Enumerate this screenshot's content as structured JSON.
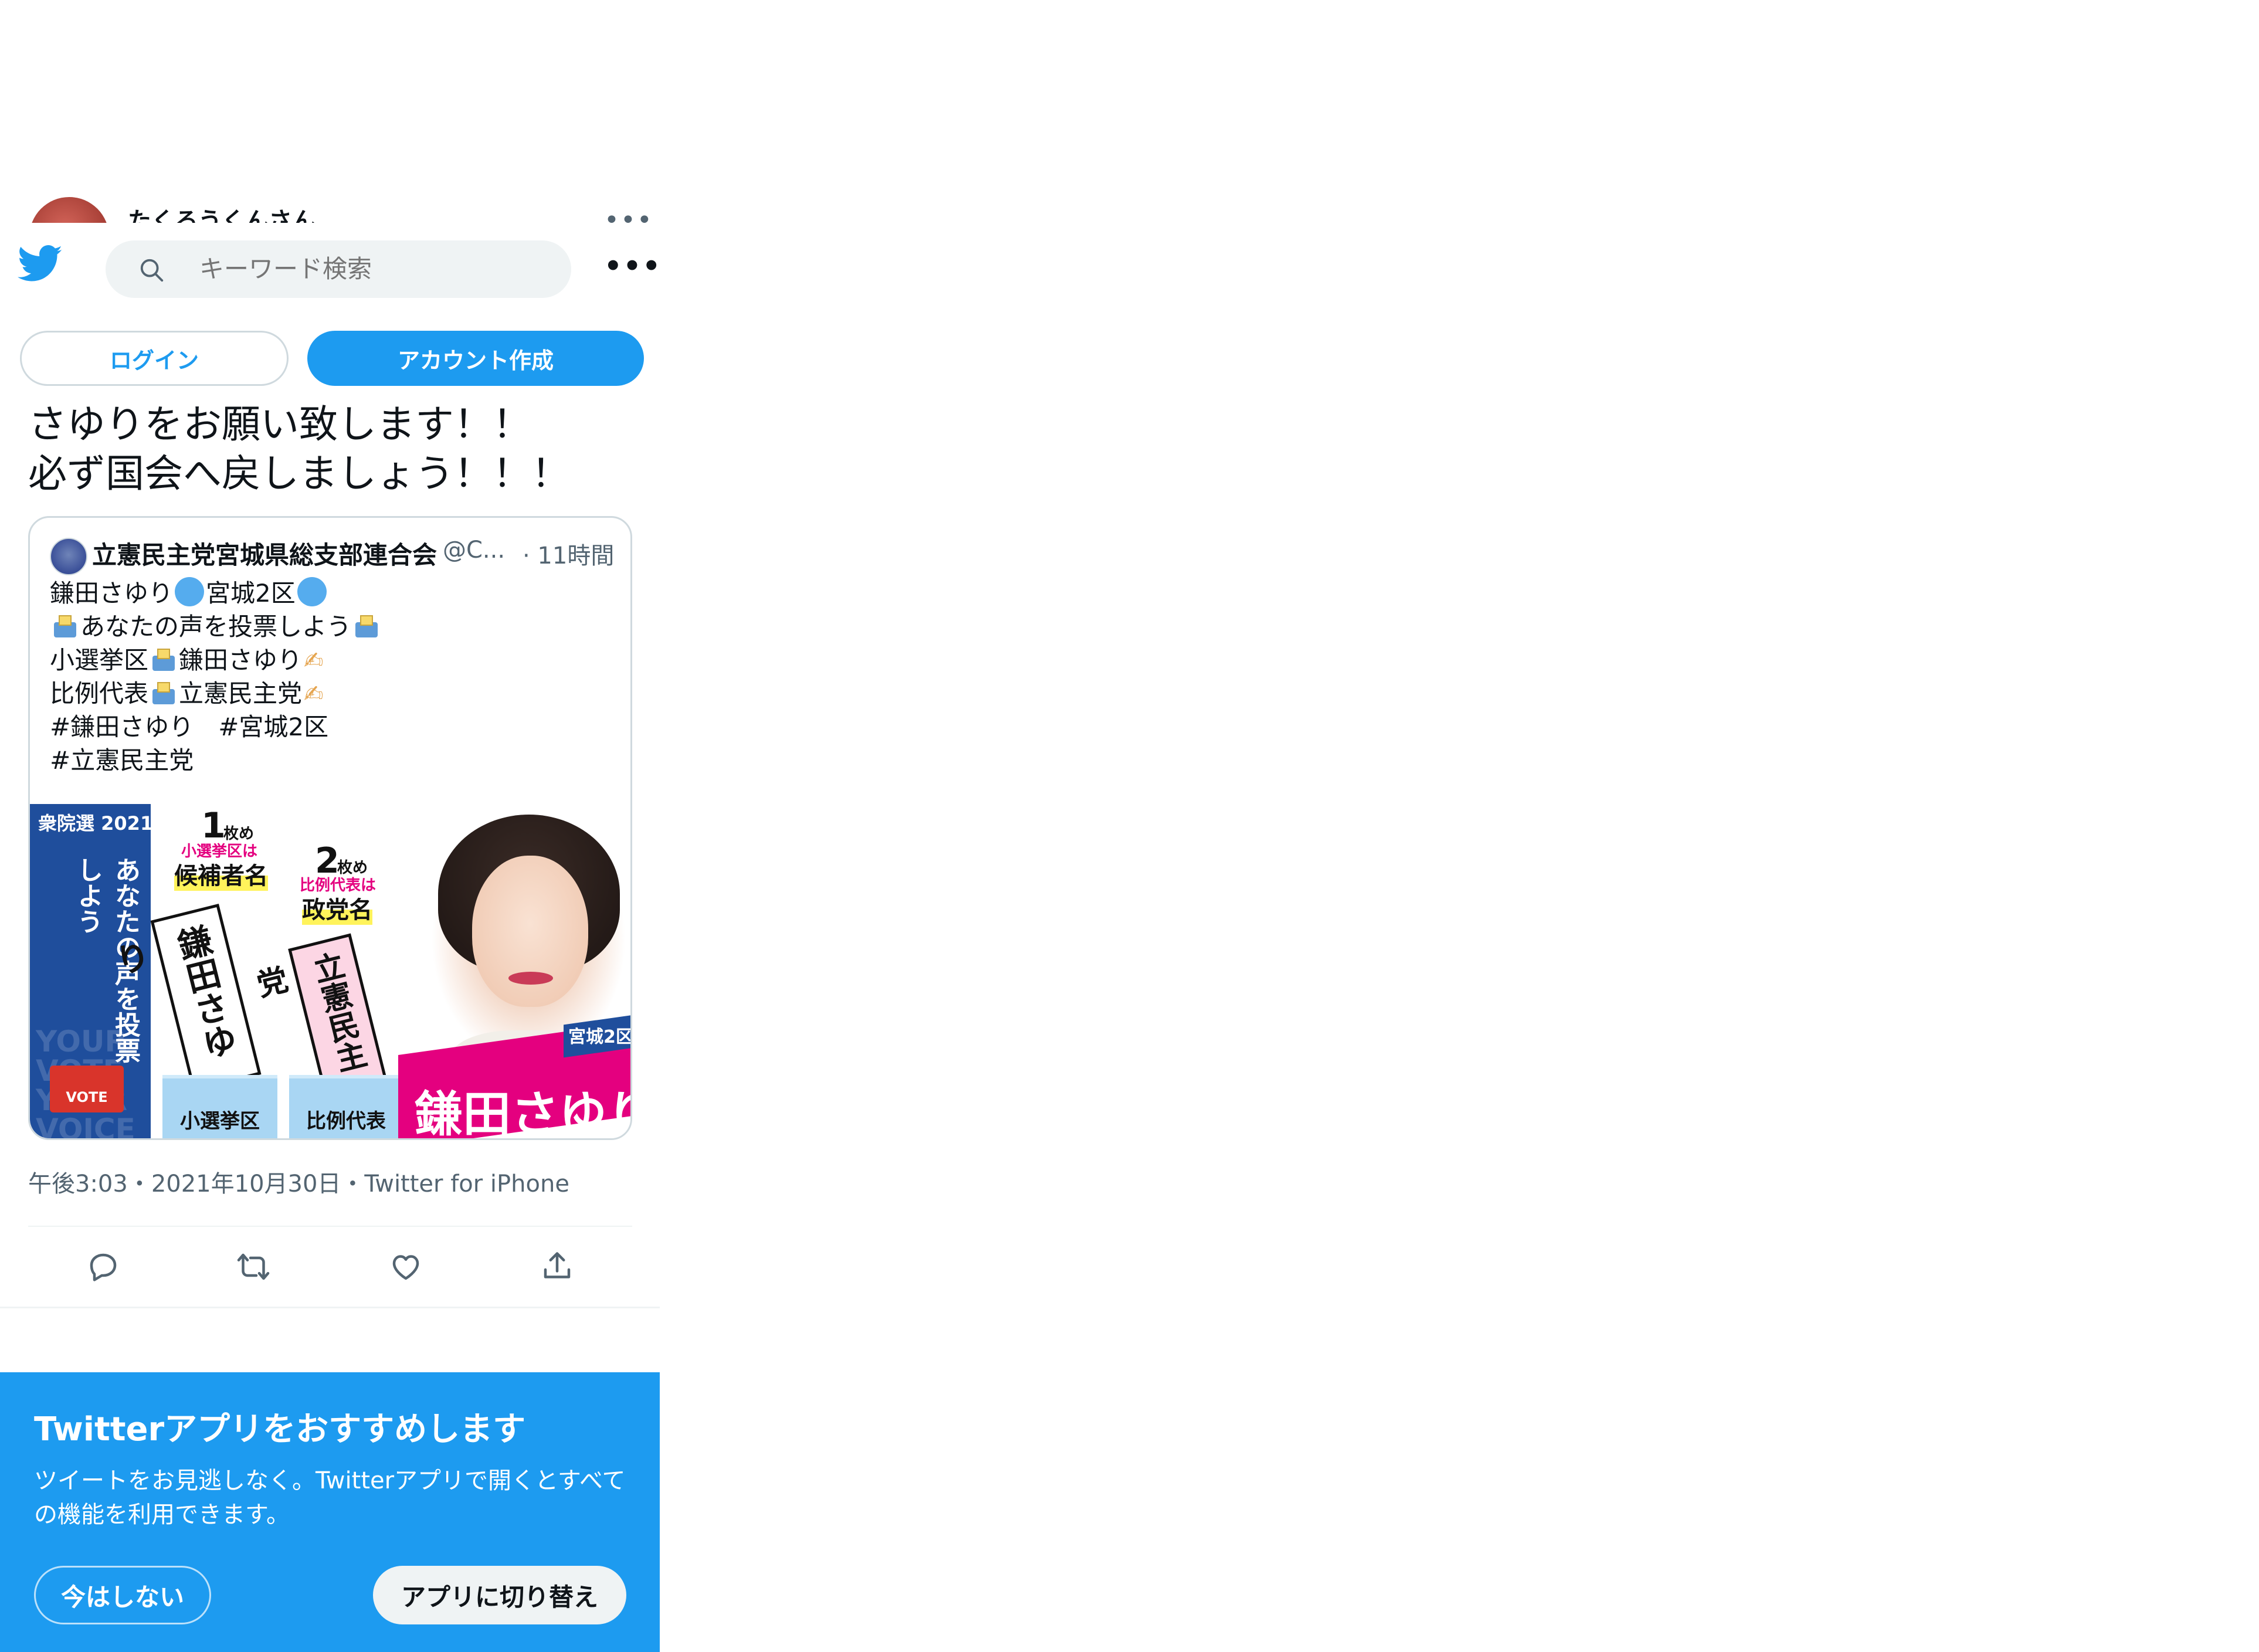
{
  "ghost_header": {
    "name": "たくろうくんさん",
    "more": "•••"
  },
  "topbar": {
    "search_placeholder": "キーワード検索",
    "more": "•••"
  },
  "auth": {
    "login_label": "ログイン",
    "signup_label": "アカウント作成"
  },
  "tweet": {
    "text": "さゆりをお願い致します！！\n必ず国会へ戻しましょう！！！",
    "meta": "午後3:03・2021年10月30日・Twitter for iPhone"
  },
  "quote": {
    "author": "立憲民主党宮城県総支部連合会",
    "handle": "@C...",
    "time": "· 11時間",
    "lines": {
      "l1a": "鎌田さゆり",
      "l1b": "宮城2区",
      "l2": "あなたの声を投票しよう",
      "l3a": "小選挙区",
      "l3b": "鎌田さゆり",
      "l4a": "比例代表",
      "l4b": "立憲民主党",
      "l5": "#鎌田さゆり　#宮城2区",
      "l6": "#立憲民主党"
    }
  },
  "poster": {
    "year": "衆院選 2021",
    "slogan": "あなたの声を投票しよう",
    "bg_text": "YOUR VOTE YOUR VOICE",
    "vote": "VOTE",
    "first_num": "1",
    "first_unit": "枚め",
    "first_sub": "小選挙区は",
    "first_label": "候補者名",
    "second_num": "2",
    "second_unit": "枚め",
    "second_sub": "比例代表は",
    "second_label": "政党名",
    "card1": "鎌田さゆり",
    "card2": "立憲民主党",
    "box1": "小選挙区",
    "box2": "比例代表",
    "district": "宮城2区",
    "name": "鎌田さゆり"
  },
  "promo": {
    "title": "Twitterアプリをおすすめします",
    "description": "ツイートをお見逃しなく。Twitterアプリで開くとすべての機能を利用できます。",
    "not_now": "今はしない",
    "switch": "アプリに切り替え"
  },
  "colors": {
    "brand_blue": "#1d9bf0",
    "text": "#0f1419",
    "secondary": "#536471",
    "party_blue": "#1f4e9c",
    "party_pink": "#e4007f"
  }
}
